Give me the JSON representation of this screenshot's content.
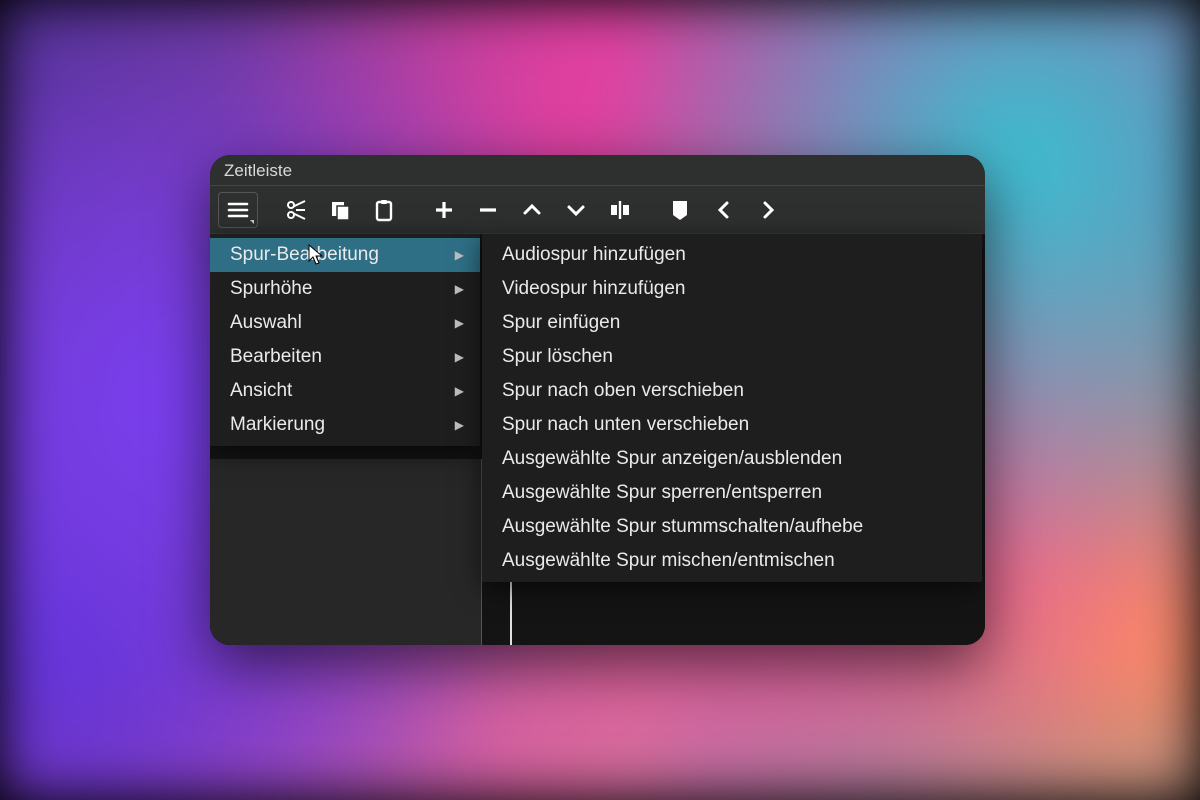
{
  "window": {
    "title": "Zeitleiste"
  },
  "toolbar": {
    "icons": [
      "menu",
      "cut",
      "copy",
      "paste",
      "add",
      "remove",
      "up",
      "down",
      "split",
      "marker",
      "prev",
      "next"
    ]
  },
  "menu": {
    "items": [
      {
        "label": "Spur-Bearbeitung",
        "selected": true
      },
      {
        "label": "Spurhöhe"
      },
      {
        "label": "Auswahl"
      },
      {
        "label": "Bearbeiten"
      },
      {
        "label": "Ansicht"
      },
      {
        "label": "Markierung"
      }
    ]
  },
  "submenu": {
    "items": [
      "Audiospur hinzufügen",
      "Videospur hinzufügen",
      "Spur einfügen",
      "Spur löschen",
      "Spur nach oben verschieben",
      "Spur nach unten verschieben",
      "Ausgewählte Spur anzeigen/ausblenden",
      "Ausgewählte Spur sperren/entsperren",
      "Ausgewählte Spur stummschalten/aufhebe",
      "Ausgewählte Spur mischen/entmischen"
    ]
  }
}
